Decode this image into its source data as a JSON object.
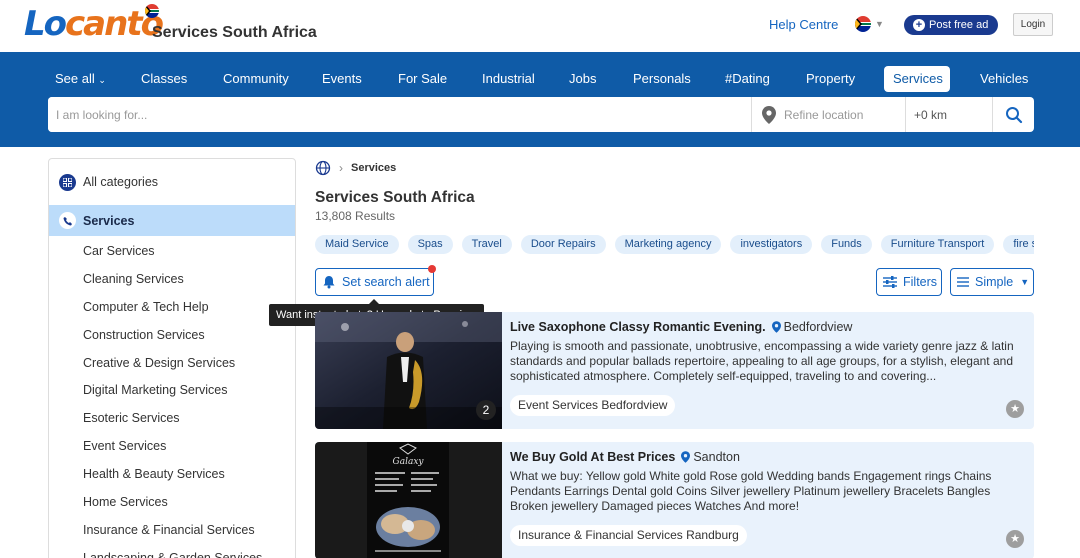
{
  "header": {
    "logo_part1": "Lo",
    "logo_part2": "canto",
    "site_title": "Services South Africa",
    "help_label": "Help Centre",
    "post_label": "Post free ad",
    "login_label": "Login"
  },
  "nav": {
    "items": [
      {
        "label": "See all"
      },
      {
        "label": "Classes"
      },
      {
        "label": "Community"
      },
      {
        "label": "Events"
      },
      {
        "label": "For Sale"
      },
      {
        "label": "Industrial"
      },
      {
        "label": "Jobs"
      },
      {
        "label": "Personals"
      },
      {
        "label": "#Dating"
      },
      {
        "label": "Property"
      },
      {
        "label": "Services"
      },
      {
        "label": "Vehicles"
      }
    ],
    "active": "Services",
    "search_placeholder": "I am looking for...",
    "location_placeholder": "Refine location",
    "radius": "+0 km"
  },
  "sidebar": {
    "all_label": "All categories",
    "active_label": "Services",
    "items": [
      {
        "label": "Car Services"
      },
      {
        "label": "Cleaning Services"
      },
      {
        "label": "Computer & Tech Help"
      },
      {
        "label": "Construction Services"
      },
      {
        "label": "Creative & Design Services"
      },
      {
        "label": "Digital Marketing Services"
      },
      {
        "label": "Esoteric Services"
      },
      {
        "label": "Event Services"
      },
      {
        "label": "Health & Beauty Services"
      },
      {
        "label": "Home Services"
      },
      {
        "label": "Insurance & Financial Services"
      },
      {
        "label": "Landscaping & Garden Services"
      }
    ]
  },
  "main": {
    "breadcrumb": "Services",
    "title": "Services South Africa",
    "results": "13,808 Results",
    "tags": [
      "Maid Service",
      "Spas",
      "Travel",
      "Door Repairs",
      "Marketing agency",
      "investigators",
      "Funds",
      "Furniture Transport",
      "fire safety"
    ],
    "alert_label": "Set search alert",
    "tooltip": "Want instant alerts? Upgrade to Premium",
    "filters_label": "Filters",
    "view_label": "Simple"
  },
  "listings": [
    {
      "title": "Live Saxophone Classy Romantic Evening.",
      "location": "Bedfordview",
      "description": "Playing is smooth and passionate, unobtrusive, encompassing a wide variety genre jazz & latin standards and popular ballads repertoire, appealing to all age groups, for a stylish, elegant and sophisticated atmosphere. Completely self-equipped, traveling to and covering...",
      "category": "Event Services Bedfordview",
      "image_count": "2"
    },
    {
      "title": "We Buy Gold At Best Prices",
      "location": "Sandton",
      "description": "What we buy: Yellow gold White gold Rose gold Wedding bands Engagement rings Chains Pendants Earrings Dental gold Coins Silver jewellery Platinum jewellery Bracelets Bangles Broken jewellery Damaged pieces Watches And more!",
      "category": "Insurance & Financial Services Randburg"
    }
  ],
  "colors": {
    "brand_blue": "#0f5ba7",
    "brand_orange": "#e8731c",
    "active_bg": "#bcdcfa"
  }
}
